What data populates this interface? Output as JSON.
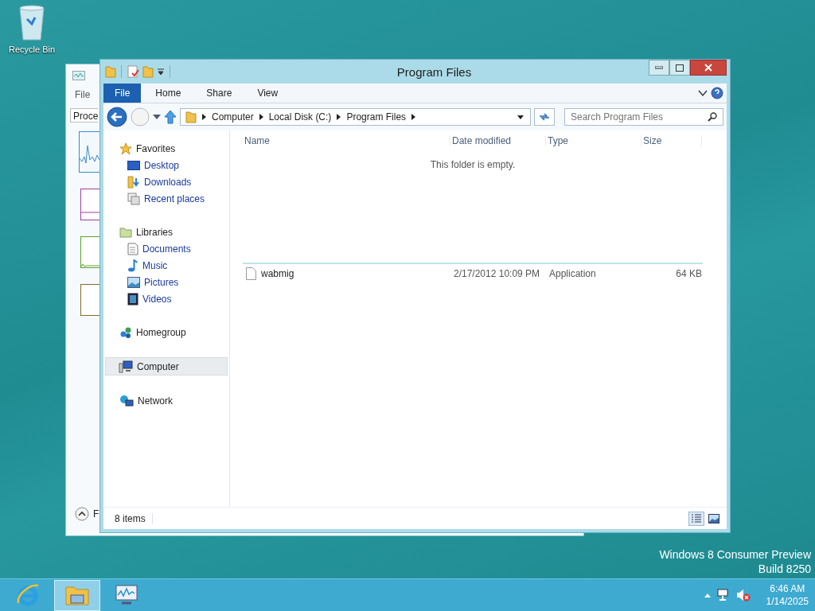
{
  "desktop": {
    "icons": [
      {
        "label": "Recycle Bin"
      }
    ],
    "edition_text": [
      "Windows 8 Consumer Preview",
      "Build 8250"
    ]
  },
  "background_window": {
    "menu": [
      "File"
    ],
    "tab": "Proce",
    "footer": "F"
  },
  "window": {
    "title": "Program Files",
    "ribbon_tabs": [
      {
        "label": "File",
        "selected": true
      },
      {
        "label": "Home",
        "selected": false
      },
      {
        "label": "Share",
        "selected": false
      },
      {
        "label": "View",
        "selected": false
      }
    ],
    "address": {
      "crumbs": [
        "Computer",
        "Local Disk (C:)",
        "Program Files"
      ]
    },
    "search": {
      "placeholder": "Search Program Files"
    },
    "nav": [
      {
        "label": "Favorites",
        "kind": "star",
        "selected": false,
        "children": [
          {
            "label": "Desktop",
            "kind": "desktop",
            "selected": false
          },
          {
            "label": "Downloads",
            "kind": "downloads",
            "selected": false
          },
          {
            "label": "Recent places",
            "kind": "recent",
            "selected": false
          }
        ]
      },
      {
        "label": "Libraries",
        "kind": "library",
        "selected": false,
        "children": [
          {
            "label": "Documents",
            "kind": "document",
            "selected": false
          },
          {
            "label": "Music",
            "kind": "music",
            "selected": false
          },
          {
            "label": "Pictures",
            "kind": "pictures",
            "selected": false
          },
          {
            "label": "Videos",
            "kind": "videos",
            "selected": false
          }
        ]
      },
      {
        "label": "Homegroup",
        "kind": "homegroup",
        "selected": false
      },
      {
        "label": "Computer",
        "kind": "computer",
        "selected": true
      },
      {
        "label": "Network",
        "kind": "network",
        "selected": false
      }
    ],
    "columns": [
      "Name",
      "Date modified",
      "Type",
      "Size"
    ],
    "empty_message": "This folder is empty.",
    "rows": [
      {
        "name": "wabmig",
        "date": "2/17/2012 10:09 PM",
        "type": "Application",
        "size": "64 KB"
      }
    ],
    "status": "8 items",
    "views": [
      {
        "kind": "details",
        "selected": true
      },
      {
        "kind": "tiles",
        "selected": false
      }
    ]
  },
  "taskbar": {
    "apps": [
      {
        "kind": "browser",
        "active": false
      },
      {
        "kind": "explorer",
        "active": true
      },
      {
        "kind": "monitor",
        "active": false
      }
    ],
    "clock": {
      "time": "6:46 AM",
      "date": "1/14/2025"
    }
  }
}
